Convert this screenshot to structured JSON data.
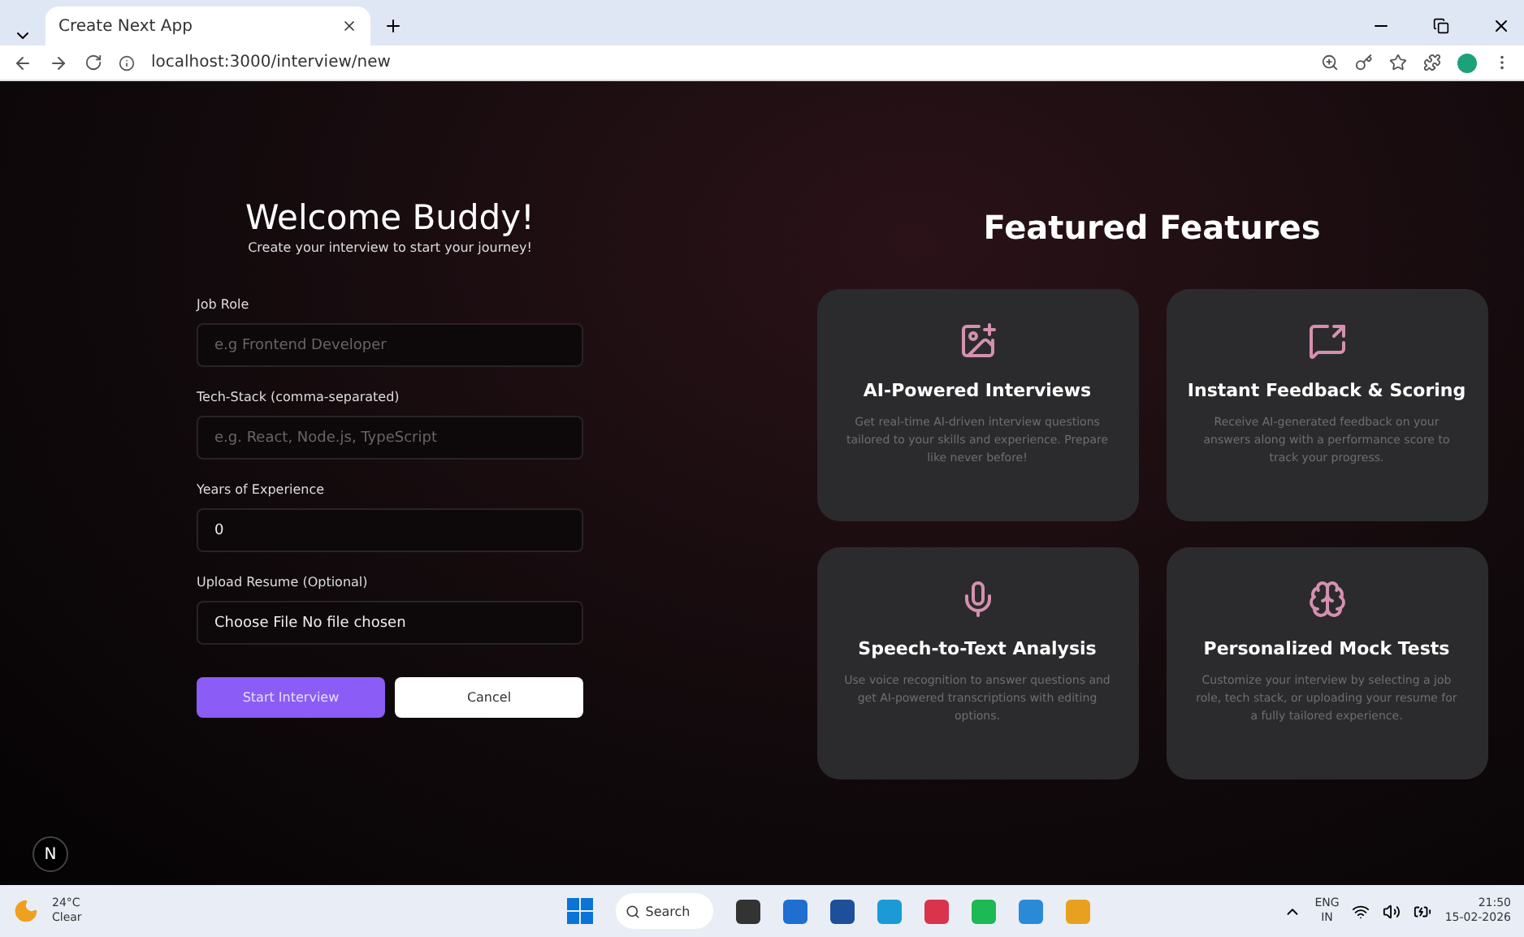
{
  "browser": {
    "tabs": [
      {
        "title": "Create Next App",
        "selected": true
      }
    ],
    "url": "localhost:3000/interview/new"
  },
  "form": {
    "title": "Welcome Buddy!",
    "subtitle": "Create your interview to start your journey!",
    "fields": [
      {
        "label": "Job Role",
        "kind": "text",
        "placeholder": "e.g Frontend Developer"
      },
      {
        "label": "Tech-Stack (comma-separated)",
        "kind": "text",
        "placeholder": "e.g. React, Node.js, TypeScript"
      },
      {
        "label": "Years of Experience",
        "kind": "number",
        "value": "0"
      },
      {
        "label": "Upload Resume (Optional)",
        "kind": "file",
        "button": "Choose File",
        "value": "No file chosen"
      }
    ],
    "buttons": [
      {
        "label": "Start Interview",
        "kind": "primary"
      },
      {
        "label": "Cancel",
        "kind": "secondary"
      }
    ]
  },
  "features": {
    "title": "Featured Features",
    "cards": [
      {
        "kind": "image",
        "title": "AI-Powered Interviews",
        "text": "Get real-time AI-driven interview questions tailored to your skills and experience. Prepare like never before!"
      },
      {
        "kind": "feedback",
        "title": "Instant Feedback & Scoring",
        "text": "Receive AI-generated feedback on your answers along with a performance score to track your progress."
      },
      {
        "kind": "mic",
        "title": "Speech-to-Text Analysis",
        "text": "Use voice recognition to answer questions and get AI-powered transcriptions with editing options."
      },
      {
        "kind": "head",
        "title": "Personalized Mock Tests",
        "text": "Customize your interview by selecting a job role, tech stack, or uploading your resume for a fully tailored experience."
      }
    ]
  },
  "dev_badge": "N",
  "taskbar": {
    "weather": {
      "temp": "24°C",
      "condition": "Clear"
    },
    "search": "Search",
    "lang": [
      "ENG",
      "IN"
    ],
    "time": "21:50",
    "date": "15-02-2026"
  }
}
